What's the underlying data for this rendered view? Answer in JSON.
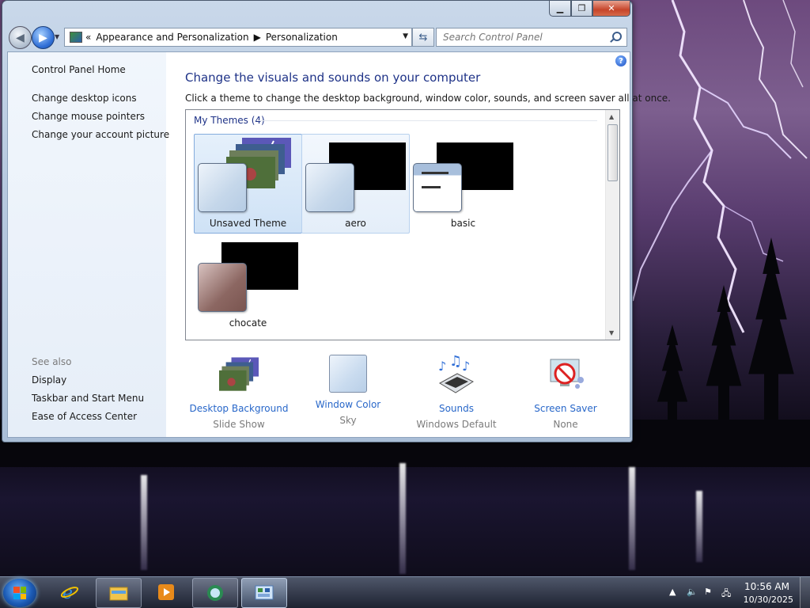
{
  "window": {
    "caption": {
      "minimize": "▁",
      "maximize": "❐",
      "close": "✕"
    },
    "address": {
      "overflow": "«",
      "crumbs": [
        "Appearance and Personalization",
        "Personalization"
      ]
    },
    "search_placeholder": "Search Control Panel"
  },
  "sidebar": {
    "home": "Control Panel Home",
    "links": [
      "Change desktop icons",
      "Change mouse pointers",
      "Change your account picture"
    ],
    "see_also_title": "See also",
    "see_also": [
      "Display",
      "Taskbar and Start Menu",
      "Ease of Access Center"
    ]
  },
  "main": {
    "help": "?",
    "title": "Change the visuals and sounds on your computer",
    "subtitle": "Click a theme to change the desktop background, window color, sounds, and screen saver all at once.",
    "group_header": "My Themes (4)",
    "themes": [
      {
        "name": "Unsaved Theme",
        "state": "selected"
      },
      {
        "name": "aero",
        "state": "hover"
      },
      {
        "name": "basic",
        "state": "normal"
      },
      {
        "name": "chocate",
        "state": "normal"
      }
    ]
  },
  "settings": [
    {
      "label": "Desktop Background",
      "value": "Slide Show",
      "icon": "slideshow-icon"
    },
    {
      "label": "Window Color",
      "value": "Sky",
      "icon": "window-color-icon"
    },
    {
      "label": "Sounds",
      "value": "Windows Default",
      "icon": "sounds-icon"
    },
    {
      "label": "Screen Saver",
      "value": "None",
      "icon": "screen-saver-icon"
    }
  ],
  "taskbar": {
    "pinned": [
      "internet-explorer-icon",
      "windows-explorer-icon",
      "media-player-icon",
      "network-icon",
      "control-panel-icon"
    ],
    "clock_time": "10:56 AM",
    "clock_date": "10/30/2025"
  },
  "colors": {
    "title_blue": "#1e3287",
    "link_blue": "#2867c9",
    "selection_fill": "#cfe2f6",
    "selection_border": "#84acdd"
  }
}
